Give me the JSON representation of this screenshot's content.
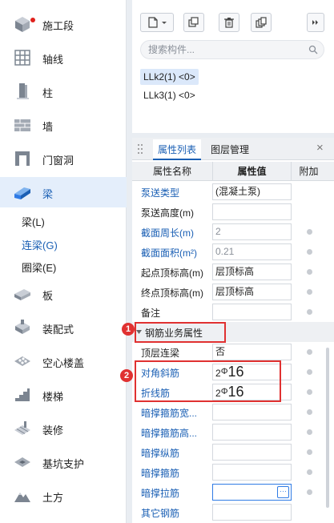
{
  "sidebar": {
    "items": [
      {
        "label": "施工段",
        "icon": "construction-segment-icon"
      },
      {
        "label": "轴线",
        "icon": "axis-grid-icon"
      },
      {
        "label": "柱",
        "icon": "column-icon"
      },
      {
        "label": "墙",
        "icon": "wall-icon"
      },
      {
        "label": "门窗洞",
        "icon": "door-window-icon"
      },
      {
        "label": "梁",
        "icon": "beam-icon"
      },
      {
        "label": "板",
        "icon": "slab-icon"
      },
      {
        "label": "装配式",
        "icon": "prefab-icon"
      },
      {
        "label": "空心楼盖",
        "icon": "hollow-floor-icon"
      },
      {
        "label": "楼梯",
        "icon": "stairs-icon"
      },
      {
        "label": "装修",
        "icon": "decoration-icon"
      },
      {
        "label": "基坑支护",
        "icon": "pit-support-icon"
      },
      {
        "label": "土方",
        "icon": "earthwork-icon"
      }
    ],
    "beam_sub_items": [
      "梁(L)",
      "连梁(G)",
      "圈梁(E)"
    ]
  },
  "toolbar": {
    "new_icon": "new-component-icon",
    "copy_icon": "copy-icon",
    "delete_icon": "delete-icon",
    "duplicate_icon": "duplicate-icon",
    "more_icon": "expand-more-icon"
  },
  "search": {
    "placeholder": "搜索构件..."
  },
  "components": [
    "LLk2(1) <0>",
    "LLk3(1) <0>"
  ],
  "prop_panel": {
    "tabs": [
      "属性列表",
      "图层管理"
    ],
    "close": "×",
    "headers": {
      "name": "属性名称",
      "value": "属性值",
      "extra": "附加"
    },
    "rows": [
      {
        "name": "泵送类型",
        "value": "(混凝土泵)"
      },
      {
        "name": "泵送高度(m)",
        "value": ""
      },
      {
        "name": "截面周长(m)",
        "value": "2"
      },
      {
        "name": "截面面积(m²)",
        "value": "0.21"
      },
      {
        "name": "起点顶标高(m)",
        "value": "层顶标高"
      },
      {
        "name": "终点顶标高(m)",
        "value": "层顶标高"
      },
      {
        "name": "备注",
        "value": ""
      },
      {
        "name": "钢筋业务属性",
        "value": ""
      },
      {
        "name": "顶层连梁",
        "value": "否"
      },
      {
        "name": "对角斜筋",
        "value_count": "2",
        "value_grade": "Φ",
        "value_dia": "16"
      },
      {
        "name": "折线筋",
        "value_count": "2",
        "value_grade": "Φ",
        "value_dia": "16"
      },
      {
        "name": "暗撑箍筋宽...",
        "value": ""
      },
      {
        "name": "暗撑箍筋高...",
        "value": ""
      },
      {
        "name": "暗撑纵筋",
        "value": ""
      },
      {
        "name": "暗撑箍筋",
        "value": ""
      },
      {
        "name": "暗撑拉筋",
        "value": ""
      },
      {
        "name": "其它钢筋",
        "value": ""
      }
    ],
    "ellipsis": "···"
  },
  "annotations": {
    "badge1": "1",
    "badge2": "2"
  },
  "colors": {
    "accent": "#1a5fb4",
    "highlight": "#e03131"
  }
}
